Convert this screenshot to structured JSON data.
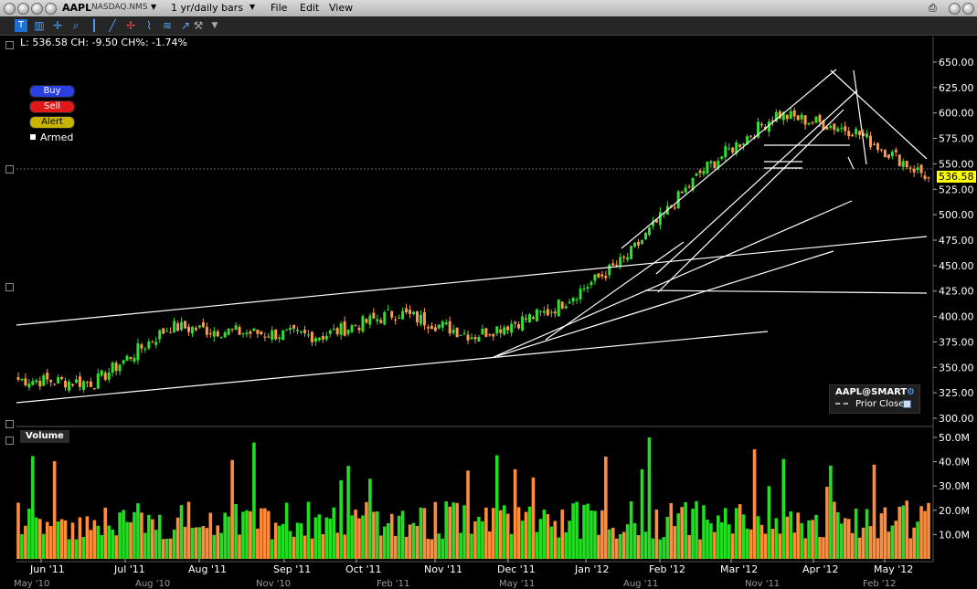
{
  "window": {
    "symbol": "AAPL",
    "exchange": "NASDAQ.NMS",
    "period": "1 yr/daily bars",
    "menus": [
      "File",
      "Edit",
      "View"
    ]
  },
  "quote_line": "L: 536.58  CH: -9.50  CH%: -1.74%",
  "order_buttons": {
    "buy": "Buy",
    "sell": "Sell",
    "alert": "Alert",
    "armed": "Armed"
  },
  "last_price_tag": "536.58",
  "legend": {
    "title": "AAPL@SMART",
    "prior_close": "Prior Close"
  },
  "volume_label": "Volume",
  "colors": {
    "up": "#33dd33",
    "down": "#ff9a4d",
    "trendline": "#ffffff",
    "price_tag": "#ffff00"
  },
  "chart_data": {
    "type": "candlestick",
    "price_axis": {
      "ticks": [
        "650.00",
        "625.00",
        "600.00",
        "575.00",
        "550.00",
        "525.00",
        "500.00",
        "475.00",
        "450.00",
        "425.00",
        "400.00",
        "375.00",
        "350.00",
        "325.00",
        "300.00"
      ],
      "ylim": [
        300,
        650
      ]
    },
    "volume_axis": {
      "ticks": [
        "50.0M",
        "40.0M",
        "30.0M",
        "20.0M",
        "10.0M"
      ],
      "ylim": [
        0,
        50
      ]
    },
    "x_labels": [
      "Jun '11",
      "Jul '11",
      "Aug '11",
      "Sep '11",
      "Oct '11",
      "Nov '11",
      "Dec '11",
      "Jan '12",
      "Feb '12",
      "Mar '12",
      "Apr '12",
      "May '12"
    ],
    "overview_labels": [
      "May '10",
      "Aug '10",
      "Nov '10",
      "Feb '11",
      "May '11",
      "Aug '11",
      "Nov '11",
      "Feb '12"
    ],
    "monthly_close": [
      {
        "month": "Jun '11",
        "close": 335
      },
      {
        "month": "Jul '11",
        "close": 390
      },
      {
        "month": "Aug '11",
        "close": 384
      },
      {
        "month": "Sep '11",
        "close": 381
      },
      {
        "month": "Oct '11",
        "close": 404
      },
      {
        "month": "Nov '11",
        "close": 381
      },
      {
        "month": "Dec '11",
        "close": 405
      },
      {
        "month": "Jan '12",
        "close": 456
      },
      {
        "month": "Feb '12",
        "close": 542
      },
      {
        "month": "Mar '12",
        "close": 599
      },
      {
        "month": "Apr '12",
        "close": 583
      },
      {
        "month": "May '12",
        "close": 536.58
      }
    ],
    "last": 536.58,
    "change": -9.5,
    "change_pct": -1.74
  }
}
